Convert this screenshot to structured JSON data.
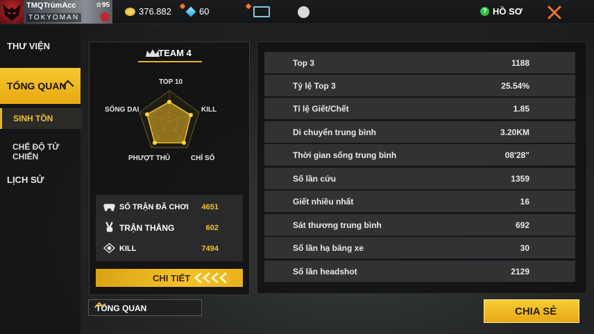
{
  "header": {
    "player_name": "TMQTrùmAcc",
    "level": "☆95",
    "team_tag": "TOKYOMAN",
    "gold": "376.882",
    "diamonds": "60",
    "profile_label": "HỒ SƠ"
  },
  "sidebar": {
    "library": "THƯ VIỆN",
    "overview": "TỔNG QUAN",
    "survival": "SINH TỒN",
    "death_match": "CHẾ ĐỘ TỬ CHIẾN",
    "history": "LỊCH SỬ"
  },
  "team_panel": {
    "team_name": "TEAM 4",
    "radar_labels": {
      "top10": "TOP 10",
      "kill": "KILL",
      "support": "CHỈ SỐ",
      "assist": "PHƯỢT THỦ",
      "survival": "SỐNG DAI"
    },
    "stats": [
      {
        "label": "SỐ TRẬN ĐÃ CHƠI",
        "value": "4651",
        "icon": "gamepad-icon"
      },
      {
        "label": "TRẬN THẮNG",
        "value": "602",
        "icon": "victory-hand-icon"
      },
      {
        "label": "KILL",
        "value": "7494",
        "icon": "kill-skull-icon"
      }
    ],
    "detail_button": "CHI TIẾT"
  },
  "dropdown": {
    "selected": "TỔNG QUAN"
  },
  "details": [
    {
      "label": "Top 3",
      "value": "1188"
    },
    {
      "label": "Tỷ lệ Top 3",
      "value": "25.54%"
    },
    {
      "label": "Tỉ lệ Giết/Chết",
      "value": "1.85"
    },
    {
      "label": "Di chuyển trung bình",
      "value": "3.20KM"
    },
    {
      "label": "Thời gian sống trung bình",
      "value": "08'28\""
    },
    {
      "label": "Số lần cứu",
      "value": "1359"
    },
    {
      "label": "Giết nhiều nhất",
      "value": "16"
    },
    {
      "label": "Sát thương trung bình",
      "value": "692"
    },
    {
      "label": "Số lần hạ băng xe",
      "value": "30"
    },
    {
      "label": "Số lần headshot",
      "value": "2129"
    }
  ],
  "share_button": "CHIA SẺ",
  "colors": {
    "accent": "#f2c230",
    "panel": "#343537"
  }
}
